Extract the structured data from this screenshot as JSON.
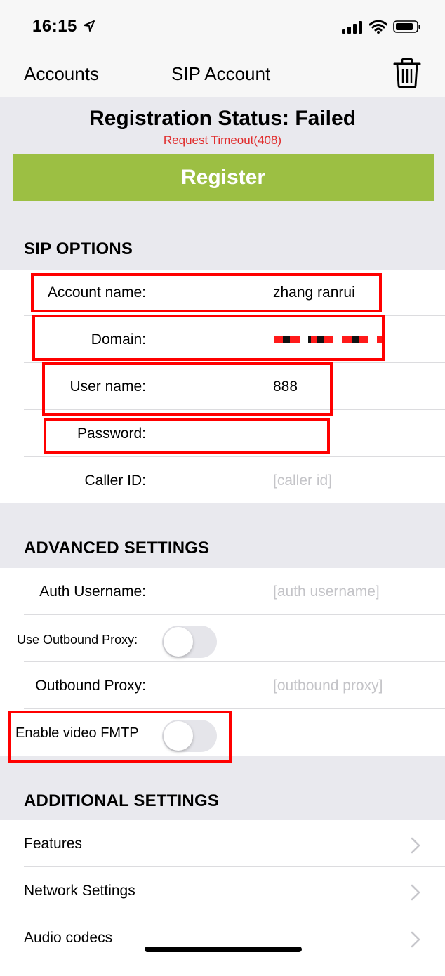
{
  "status_bar": {
    "time": "16:15"
  },
  "nav": {
    "back_label": "Accounts",
    "title": "SIP Account",
    "trash_icon": "trash-icon"
  },
  "registration": {
    "title": "Registration Status: Failed",
    "subtitle": "Request Timeout(408)",
    "button_label": "Register",
    "button_color": "#9cbf43",
    "subtitle_color": "#e02b2b"
  },
  "sip_options": {
    "header": "SIP OPTIONS",
    "account_name_label": "Account name:",
    "account_name_value": "zhang ranrui",
    "domain_label": "Domain:",
    "user_name_label": "User name:",
    "user_name_value": "888",
    "password_label": "Password:",
    "caller_id_label": "Caller ID:",
    "caller_id_placeholder": "[caller id]"
  },
  "advanced": {
    "header": "ADVANCED SETTINGS",
    "auth_username_label": "Auth Username:",
    "auth_username_placeholder": "[auth username]",
    "use_outbound_proxy_label": "Use Outbound Proxy:",
    "use_outbound_proxy_on": false,
    "outbound_proxy_label": "Outbound Proxy:",
    "outbound_proxy_placeholder": "[outbound proxy]",
    "enable_video_fmtp_label": "Enable video FMTP",
    "enable_video_fmtp_on": false
  },
  "additional": {
    "header": "ADDITIONAL SETTINGS",
    "items": [
      {
        "label": "Features"
      },
      {
        "label": "Network Settings"
      },
      {
        "label": "Audio codecs"
      }
    ]
  },
  "highlight_color": "#ff0000"
}
